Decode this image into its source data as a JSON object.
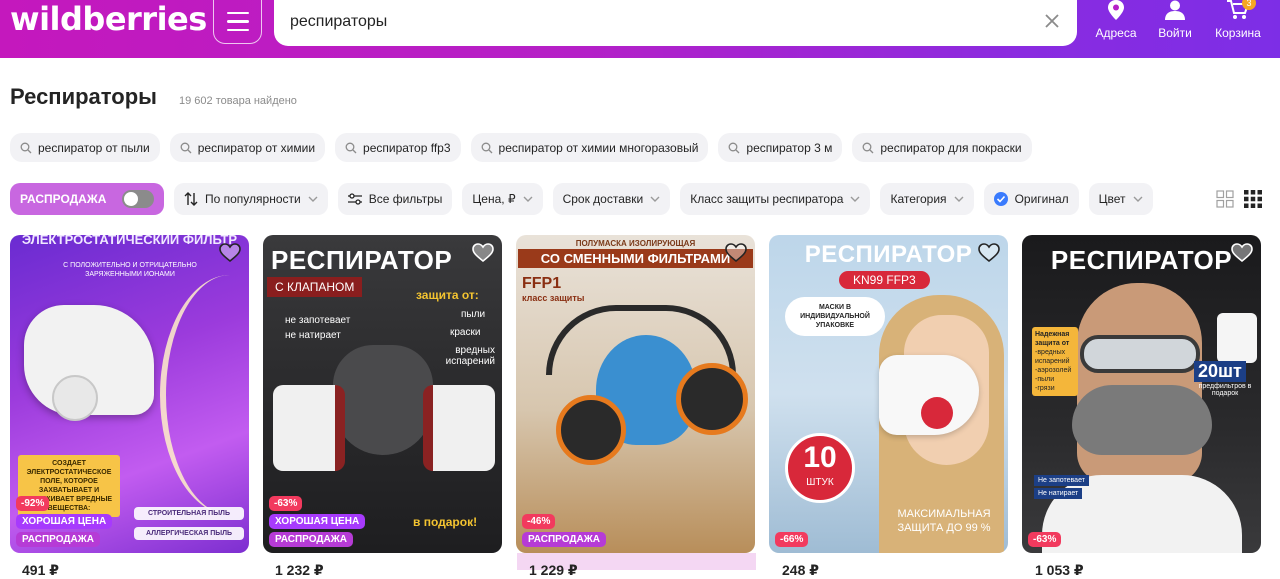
{
  "header": {
    "logo": "wildberries",
    "search_value": "респираторы",
    "address_label": "Адреса",
    "login_label": "Войти",
    "cart_label": "Корзина",
    "cart_count": "3"
  },
  "page": {
    "title": "Респираторы",
    "count": "19 602 товара найдено"
  },
  "suggestions": [
    "респиратор от пыли",
    "респиратор от химии",
    "респиратор ffp3",
    "респиратор от химии многоразовый",
    "респиратор 3 м",
    "респиратор для покраски"
  ],
  "filters": {
    "sale": "РАСПРОДАЖА",
    "sort": "По популярности",
    "all": "Все фильтры",
    "price": "Цена, ₽",
    "delivery": "Срок доставки",
    "protection": "Класс защиты респиратора",
    "category": "Категория",
    "original": "Оригинал",
    "color": "Цвет"
  },
  "cards": [
    {
      "headline": "ЭЛЕКТРОСТАТИЧЕСКИЙ ФИЛЬТР",
      "sub": "С ПОЛОЖИТЕЛЬНО И ОТРИЦАТЕЛЬНО ЗАРЯЖЕННЫМИ ИОНАМИ",
      "note": "СОЗДАЕТ ЭЛЕКТРОСТАТИЧЕСКОЕ ПОЛЕ, КОТОРОЕ ЗАХВАТЫВАЕТ И УДЕРЖИВАЕТ ВРЕДНЫЕ ВЕЩЕСТВА:",
      "tag1": "СТРОИТЕЛЬНАЯ ПЫЛЬ",
      "tag2": "АЛЛЕРГИЧЕСКАЯ ПЫЛЬ",
      "discount": "-92%",
      "good_price": "ХОРОШАЯ ЦЕНА",
      "sale": "РАСПРОДАЖА"
    },
    {
      "headline": "РЕСПИРАТОР",
      "sub": "С КЛАПАНОМ",
      "protect_title": "защита от:",
      "protect1": "пыли",
      "protect2": "краски",
      "protect3": "вредных испарений",
      "feat1": "не запотевает",
      "feat2": "не натирает",
      "gift": "в подарок!",
      "discount": "-63%",
      "good_price": "ХОРОШАЯ ЦЕНА",
      "sale": "РАСПРОДАЖА"
    },
    {
      "top": "ПОЛУМАСКА ИЗОЛИРУЮЩАЯ",
      "headline": "СО СМЕННЫМИ ФИЛЬТРАМИ",
      "cls": "FFP1",
      "cls_sub": "класс защиты",
      "discount": "-46%",
      "sale": "РАСПРОДАЖА"
    },
    {
      "headline": "РЕСПИРАТОР",
      "sub": "KN99 FFP3",
      "pack": "МАСКИ В ИНДИВИДУАЛЬНОЙ УПАКОВКЕ",
      "num": "10",
      "num_sub": "ШТУК",
      "max": "МАКСИМАЛЬНАЯ ЗАЩИТА ДО 99 %",
      "discount": "-66%"
    },
    {
      "headline": "РЕСПИРАТОР",
      "protect": "Надежная защита от",
      "p1": "-вредных испарений",
      "p2": "-аэрозолей",
      "p3": "-пыли",
      "p4": "-грязи",
      "count": "20шт",
      "count_sub": "предфильтров в подарок",
      "f1": "Не запотевает",
      "f2": "Не натирает",
      "discount": "-63%"
    }
  ],
  "prices_partial": [
    "491 ₽",
    "1 232 ₽",
    "1 229 ₽",
    "248 ₽",
    "1 053 ₽"
  ],
  "colors": {
    "brand_start": "#c418bd",
    "brand_end": "#7d2ee6",
    "discount": "#f23a5e",
    "sale": "#b63bd6"
  }
}
